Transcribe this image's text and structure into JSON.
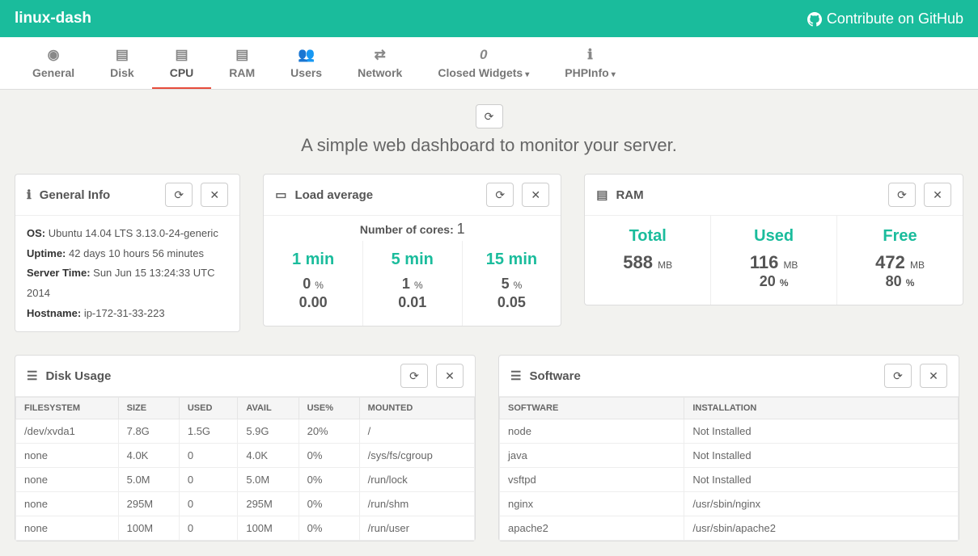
{
  "header": {
    "brand": "linux-dash",
    "github": "Contribute on GitHub"
  },
  "tabs": [
    {
      "label": "General"
    },
    {
      "label": "Disk"
    },
    {
      "label": "CPU"
    },
    {
      "label": "RAM"
    },
    {
      "label": "Users"
    },
    {
      "label": "Network"
    },
    {
      "label": "Closed Widgets"
    },
    {
      "label": "PHPInfo"
    }
  ],
  "tagline": "A simple web dashboard to monitor your server.",
  "general": {
    "title": "General Info",
    "os_l": "OS:",
    "os_v": "Ubuntu 14.04 LTS 3.13.0-24-generic",
    "up_l": "Uptime:",
    "up_v": "42 days 10 hours 56 minutes",
    "st_l": "Server Time:",
    "st_v": "Sun Jun 15 13:24:33 UTC 2014",
    "hn_l": "Hostname:",
    "hn_v": "ip-172-31-33-223"
  },
  "load": {
    "title": "Load average",
    "cores_l": "Number of cores:",
    "cores_v": "1",
    "cols": [
      {
        "label": "1 min",
        "pct": "0",
        "pu": "%",
        "val": "0.00"
      },
      {
        "label": "5 min",
        "pct": "1",
        "pu": "%",
        "val": "0.01"
      },
      {
        "label": "15 min",
        "pct": "5",
        "pu": "%",
        "val": "0.05"
      }
    ]
  },
  "ram": {
    "title": "RAM",
    "cols": [
      {
        "label": "Total",
        "big": "588",
        "u": "MB",
        "pct": "",
        "pu": ""
      },
      {
        "label": "Used",
        "big": "116",
        "u": "MB",
        "pct": "20",
        "pu": "%"
      },
      {
        "label": "Free",
        "big": "472",
        "u": "MB",
        "pct": "80",
        "pu": "%"
      }
    ]
  },
  "disk": {
    "title": "Disk Usage",
    "headers": [
      "FILESYSTEM",
      "SIZE",
      "USED",
      "AVAIL",
      "USE%",
      "MOUNTED"
    ],
    "rows": [
      [
        "/dev/xvda1",
        "7.8G",
        "1.5G",
        "5.9G",
        "20%",
        "/"
      ],
      [
        "none",
        "4.0K",
        "0",
        "4.0K",
        "0%",
        "/sys/fs/cgroup"
      ],
      [
        "none",
        "5.0M",
        "0",
        "5.0M",
        "0%",
        "/run/lock"
      ],
      [
        "none",
        "295M",
        "0",
        "295M",
        "0%",
        "/run/shm"
      ],
      [
        "none",
        "100M",
        "0",
        "100M",
        "0%",
        "/run/user"
      ]
    ]
  },
  "soft": {
    "title": "Software",
    "headers": [
      "SOFTWARE",
      "INSTALLATION"
    ],
    "rows": [
      [
        "node",
        "Not Installed"
      ],
      [
        "java",
        "Not Installed"
      ],
      [
        "vsftpd",
        "Not Installed"
      ],
      [
        "nginx",
        "/usr/sbin/nginx"
      ],
      [
        "apache2",
        "/usr/sbin/apache2"
      ]
    ]
  }
}
